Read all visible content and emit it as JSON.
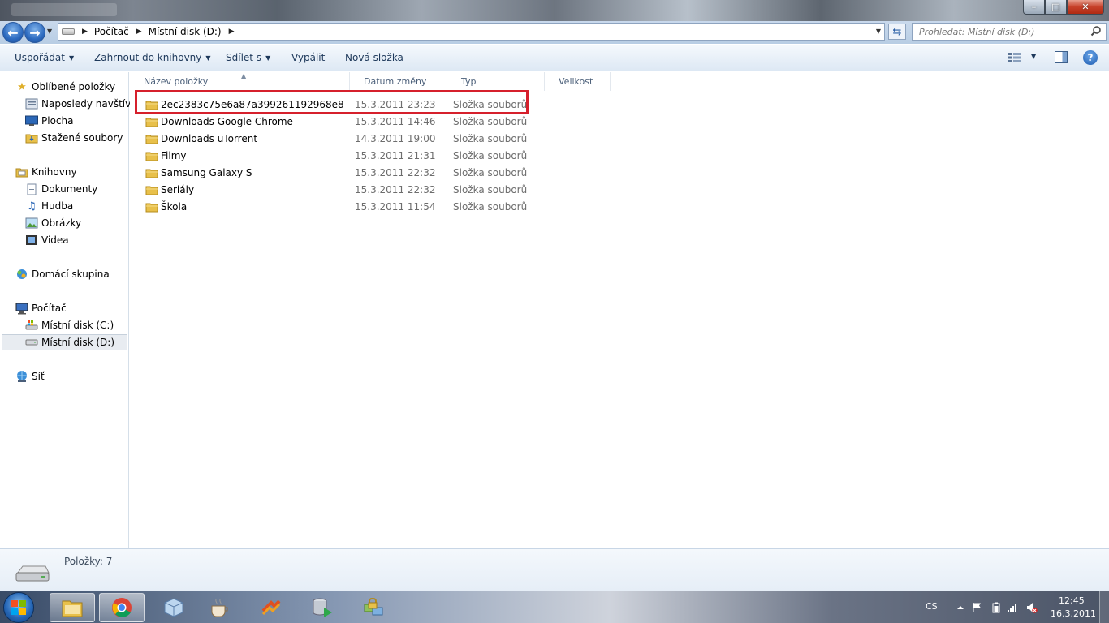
{
  "address": {
    "crumbs": [
      "Počítač",
      "Místní disk (D:)"
    ],
    "search_placeholder": "Prohledat: Místní disk (D:)"
  },
  "toolbar": {
    "organize": "Uspořádat",
    "include_library": "Zahrnout do knihovny",
    "share": "Sdílet s",
    "burn": "Vypálit",
    "new_folder": "Nová složka"
  },
  "nav": {
    "favorites": "Oblíbené položky",
    "recent": "Naposledy navštívené",
    "desktop": "Plocha",
    "downloads": "Stažené soubory",
    "libraries": "Knihovny",
    "documents": "Dokumenty",
    "music": "Hudba",
    "pictures": "Obrázky",
    "videos": "Videa",
    "homegroup": "Domácí skupina",
    "computer": "Počítač",
    "drive_c": "Místní disk (C:)",
    "drive_d": "Místní disk (D:)",
    "network": "Síť"
  },
  "columns": {
    "name": "Název položky",
    "date": "Datum změny",
    "type": "Typ",
    "size": "Velikost"
  },
  "files": [
    {
      "name": "2ec2383c75e6a87a399261192968e8",
      "date": "15.3.2011 23:23",
      "type": "Složka souborů"
    },
    {
      "name": "Downloads Google Chrome",
      "date": "15.3.2011 14:46",
      "type": "Složka souborů"
    },
    {
      "name": "Downloads uTorrent",
      "date": "14.3.2011 19:00",
      "type": "Složka souborů"
    },
    {
      "name": "Filmy",
      "date": "15.3.2011 21:31",
      "type": "Složka souborů"
    },
    {
      "name": "Samsung Galaxy S",
      "date": "15.3.2011 22:32",
      "type": "Složka souborů"
    },
    {
      "name": "Seriály",
      "date": "15.3.2011 22:32",
      "type": "Složka souborů"
    },
    {
      "name": "Škola",
      "date": "15.3.2011 11:54",
      "type": "Složka souborů"
    }
  ],
  "details": {
    "count": "Položky: 7"
  },
  "taskbar": {
    "language": "CS",
    "time": "12:45",
    "date": "16.3.2011"
  },
  "colors": {
    "highlight_box": "#d6202c",
    "folder": "#e8c04a"
  }
}
